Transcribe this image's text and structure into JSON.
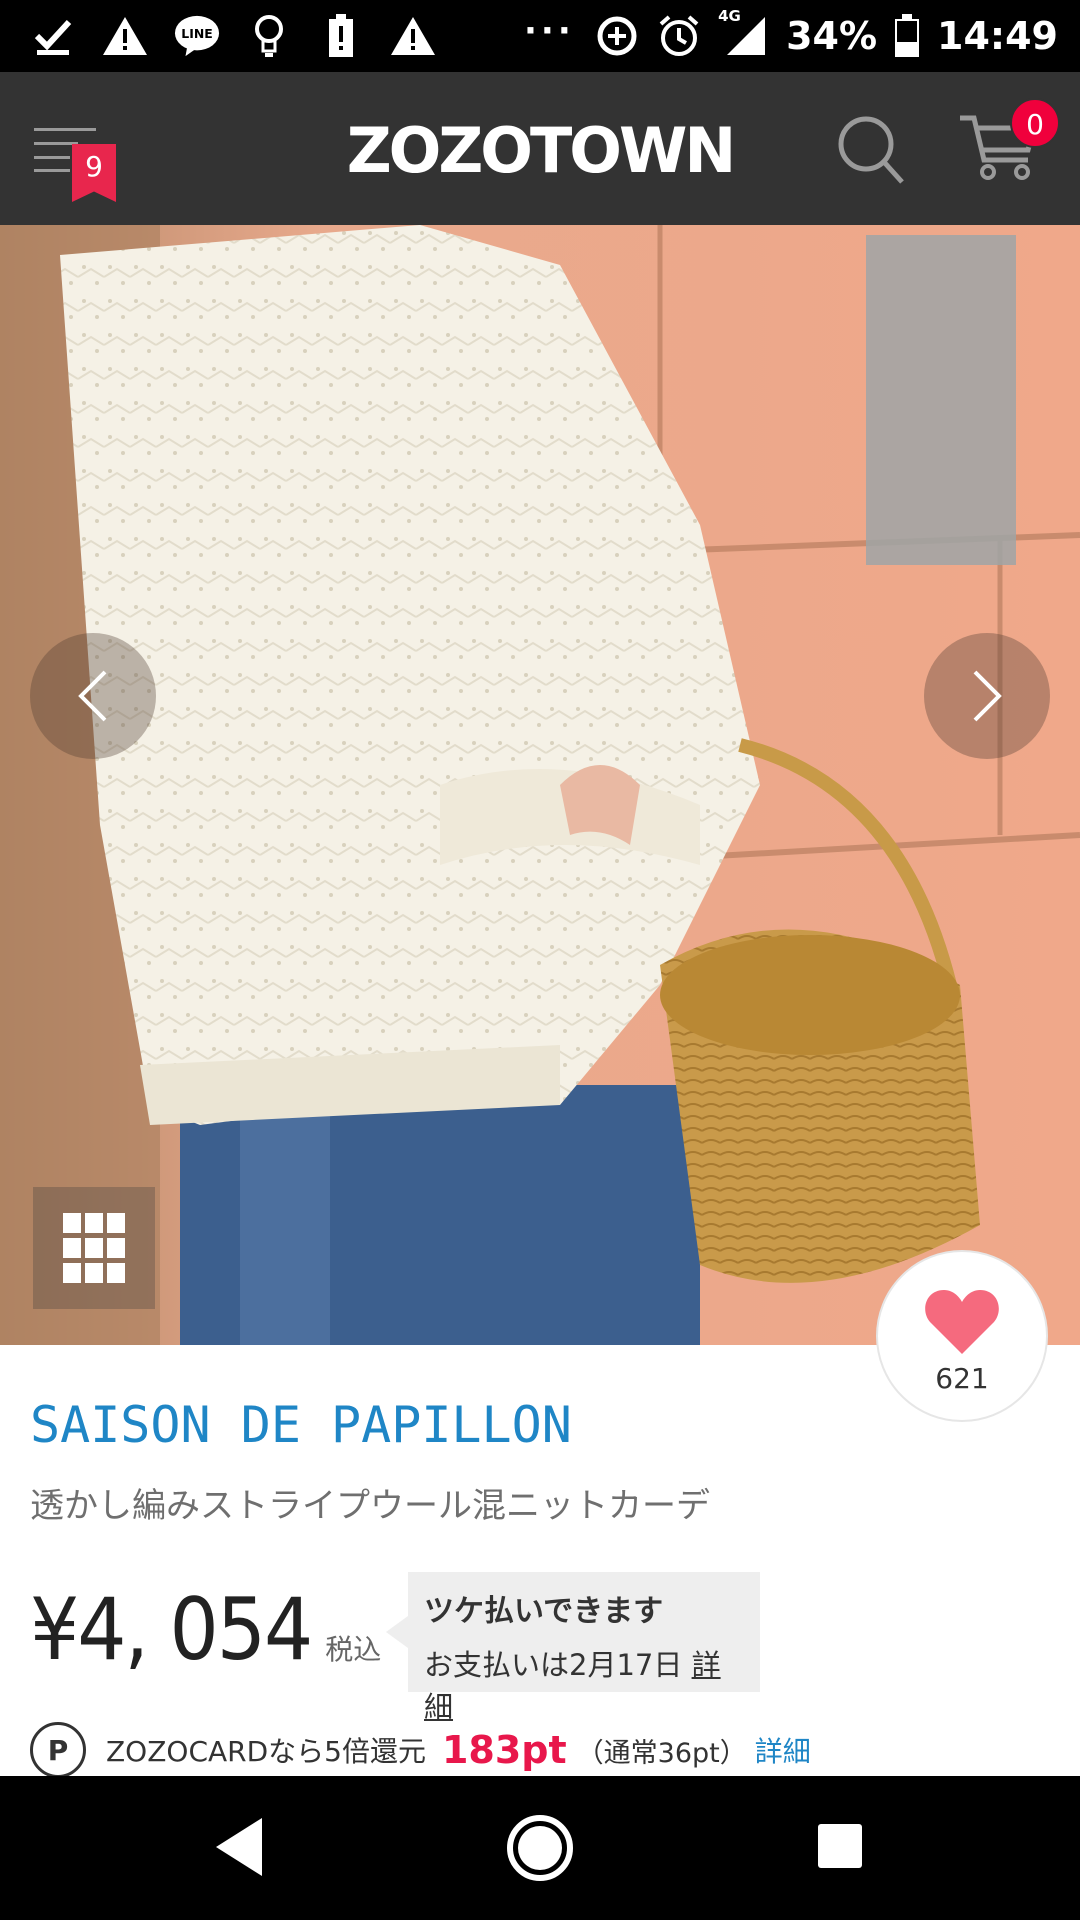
{
  "status_bar": {
    "network": "4G",
    "battery": "34%",
    "time": "14:49",
    "left_icons": [
      "check-icon",
      "warning-icon",
      "line-app-icon",
      "lightbulb-icon",
      "battery-alert-icon",
      "warning-icon"
    ],
    "overflow": "···"
  },
  "header": {
    "logo": "ZOZOTOWN",
    "menu_badge": "9",
    "cart_badge": "0"
  },
  "colors": {
    "header_bg": "#333333",
    "brand": "#1f86c6",
    "points": "#e8174b",
    "badge": "#e8264d",
    "heart": "#f56a7e"
  },
  "product": {
    "brand": "SAISON DE PAPILLON",
    "name": "透かし編みストライプウール混ニットカーデ",
    "price": "¥4, 054",
    "tax_label": "税込",
    "favorite_count": "621"
  },
  "tsuke": {
    "title": "ツケ払いできます",
    "payment": "お支払いは2月17日",
    "link": "詳細"
  },
  "points": {
    "icon": "P",
    "text": "ZOZOCARDなら5倍還元",
    "value": "183pt",
    "normal": "（通常36pt）",
    "link": "詳細"
  }
}
